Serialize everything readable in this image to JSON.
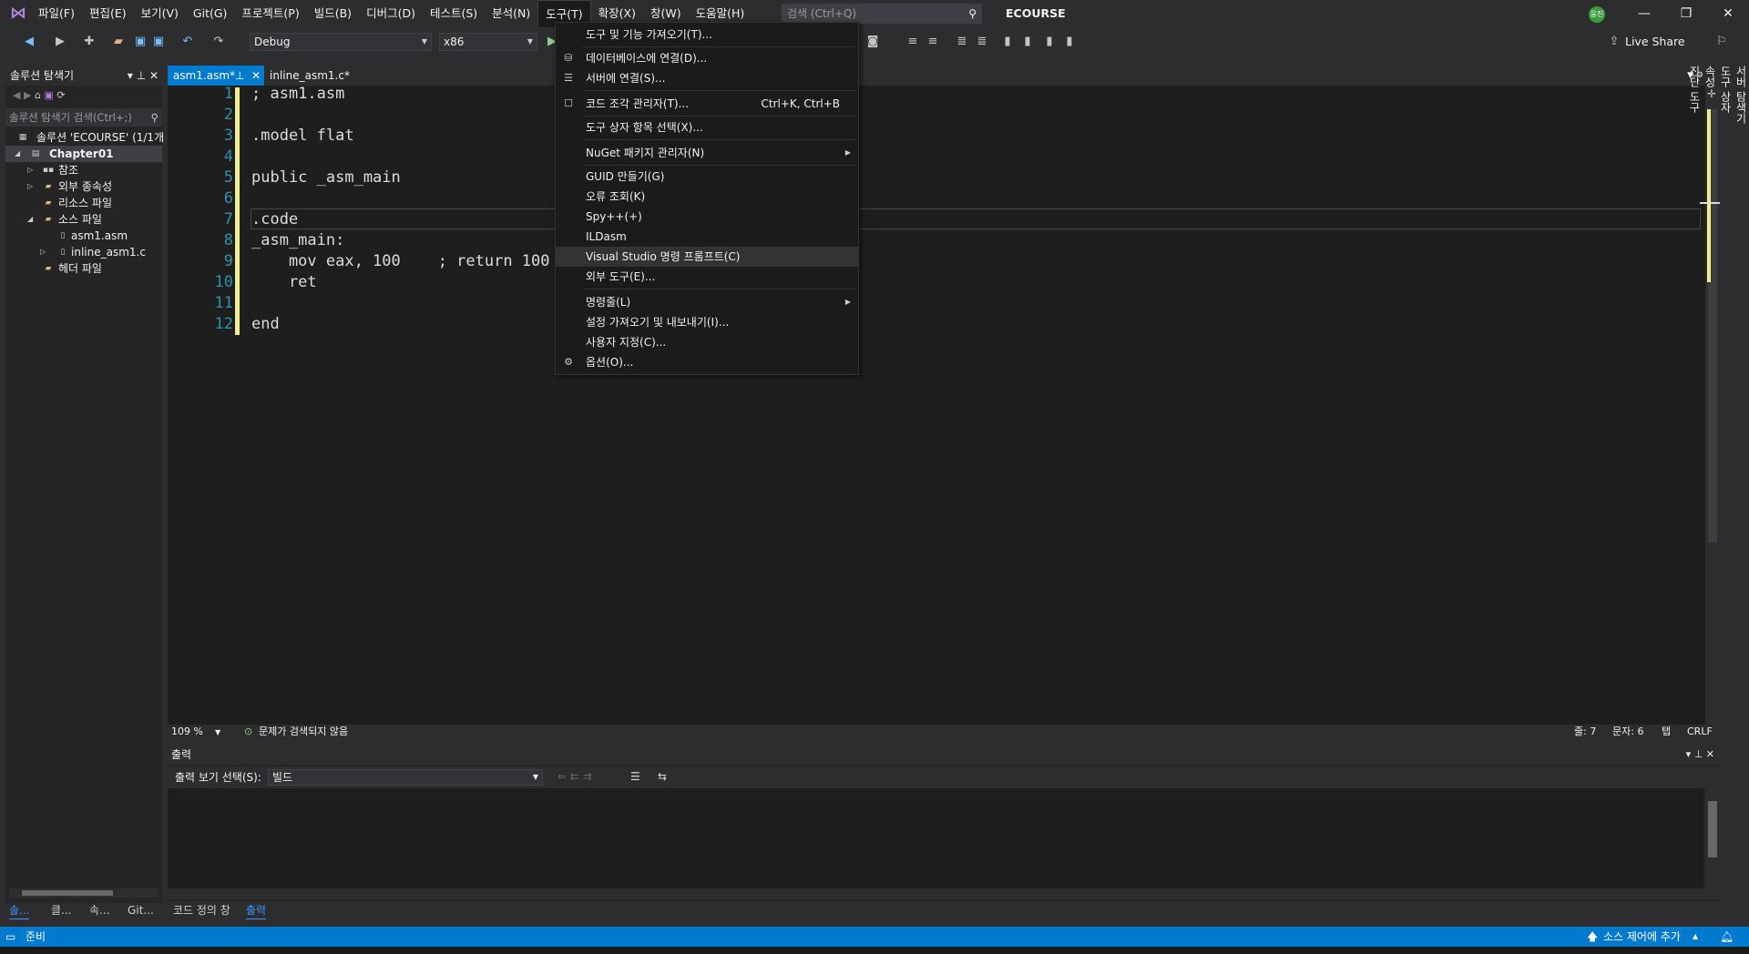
{
  "menu": [
    "파일(F)",
    "편집(E)",
    "보기(V)",
    "Git(G)",
    "프로젝트(P)",
    "빌드(B)",
    "디버그(D)",
    "테스트(S)",
    "분석(N)",
    "도구(T)",
    "확장(X)",
    "창(W)",
    "도움말(H)"
  ],
  "search": {
    "placeholder": "검색 (Ctrl+Q)"
  },
  "solution_name": "ECOURSE",
  "avatar_initials": "웅진",
  "toolbar": {
    "config": "Debug",
    "platform": "x86",
    "live_share": "Live Share"
  },
  "solution_explorer": {
    "title": "솔루션 탐색기",
    "search": "솔루션 탐색기 검색(Ctrl+;)",
    "items": [
      {
        "label": "솔루션 'ECOURSE' (1/1개"
      },
      {
        "label": "Chapter01"
      },
      {
        "label": "참조"
      },
      {
        "label": "외부 종속성"
      },
      {
        "label": "리소스 파일"
      },
      {
        "label": "소스 파일"
      },
      {
        "label": "asm1.asm"
      },
      {
        "label": "inline_asm1.c"
      },
      {
        "label": "헤더 파일"
      }
    ]
  },
  "tabs": [
    {
      "label": "asm1.asm*"
    },
    {
      "label": "inline_asm1.c*"
    }
  ],
  "code": [
    "; asm1.asm",
    "",
    ".model flat",
    "",
    "public _asm_main",
    "",
    ".code",
    "_asm_main:",
    "    mov eax, 100    ; return 100",
    "    ret",
    "",
    "end"
  ],
  "line_numbers": [
    "1",
    "2",
    "3",
    "4",
    "5",
    "6",
    "7",
    "8",
    "9",
    "10",
    "11",
    "12"
  ],
  "editor_status": {
    "zoom": "109 %",
    "issues": "문제가 검색되지 않음",
    "line": "줄: 7",
    "col": "문자: 6",
    "tab": "탭",
    "eol": "CRLF"
  },
  "output": {
    "title": "출력",
    "show_label": "출력 보기 선택(S):",
    "source": "빌드"
  },
  "bottom_tabs": [
    "솔...",
    "클...",
    "속...",
    "Git...",
    "코드 정의 창",
    "출력"
  ],
  "statusbar": {
    "ready": "준비",
    "source_control": "소스 제어에 추가"
  },
  "right_strip": [
    "서버 탐색기",
    "도구 상자",
    "속성",
    "진단 도구"
  ],
  "dropdown": [
    {
      "label": "도구 및 기능 가져오기(T)...",
      "icon": ""
    },
    {
      "label": "데이터베이스에 연결(D)...",
      "icon": "db-icon"
    },
    {
      "label": "서버에 연결(S)...",
      "icon": "server-icon"
    },
    {
      "label": "코드 조각 관리자(T)...",
      "shortcut": "Ctrl+K, Ctrl+B",
      "icon": "checkbox-icon"
    },
    {
      "label": "도구 상자 항목 선택(X)..."
    },
    {
      "label": "NuGet 패키지 관리자(N)",
      "submenu": true
    },
    {
      "label": "GUID 만들기(G)"
    },
    {
      "label": "오류 조회(K)"
    },
    {
      "label": "Spy++(+)"
    },
    {
      "label": "ILDasm"
    },
    {
      "label": "Visual Studio 명령 프롬프트(C)",
      "highlighted": true
    },
    {
      "label": "외부 도구(E)..."
    },
    {
      "label": "명령줄(L)",
      "submenu": true
    },
    {
      "label": "설정 가져오기 및 내보내기(I)..."
    },
    {
      "label": "사용자 지정(C)..."
    },
    {
      "label": "옵션(O)...",
      "icon": "gear-icon"
    }
  ]
}
